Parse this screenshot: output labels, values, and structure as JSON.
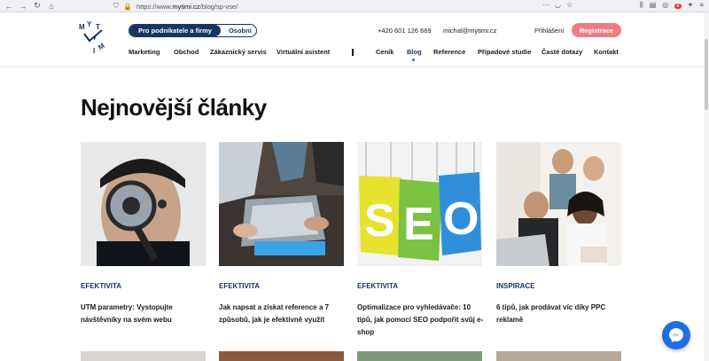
{
  "browser": {
    "back_icon": "back-arrow-icon",
    "url_prefix": "https://www.",
    "url_host": "mytimi.cz",
    "url_path": "/blog/sp-vse/"
  },
  "header": {
    "logo_letters": [
      "M",
      "Y",
      "T",
      "I",
      "M",
      "I"
    ],
    "toggle": {
      "active": "Pro podnikatele a firmy",
      "inactive": "Osobní"
    },
    "phone": "+420 601 126 669",
    "email": "michal@mytimi.cz",
    "login": "Přihlášení",
    "register": "Registrace",
    "nav": [
      "Marketing",
      "Obchod",
      "Zákaznický servis",
      "Virtuální asistent",
      "Ceník",
      "Blog",
      "Reference",
      "Případové studie",
      "Časté dotazy",
      "Kontakt"
    ],
    "active_nav": "Blog"
  },
  "main": {
    "heading": "Nejnovější články",
    "articles": [
      {
        "category": "EFEKTIVITA",
        "title": "UTM parametry: Vystopujte návštěvníky na svém webu",
        "image": "magnifying-glass-photo"
      },
      {
        "category": "EFEKTIVITA",
        "title": "Jak napsat a získat reference a 7 způsobů, jak je efektivně využít",
        "image": "laptop-hands-photo"
      },
      {
        "category": "EFEKTIVITA",
        "title": "Optimalizace pro vyhledávače: 10 tipů, jak pomocí SEO podpořit svůj e-shop",
        "image": "seo-letters-photo"
      },
      {
        "category": "INSPIRACE",
        "title": "6 tipů, jak prodávat víc díky PPC reklamě",
        "image": "team-laptop-photo"
      }
    ]
  },
  "seo_letters": [
    "S",
    "E",
    "O"
  ],
  "colors": {
    "brand": "#16355f",
    "accent": "#f07b83",
    "link": "#1f6fb8",
    "messenger": "#1f6fde"
  }
}
